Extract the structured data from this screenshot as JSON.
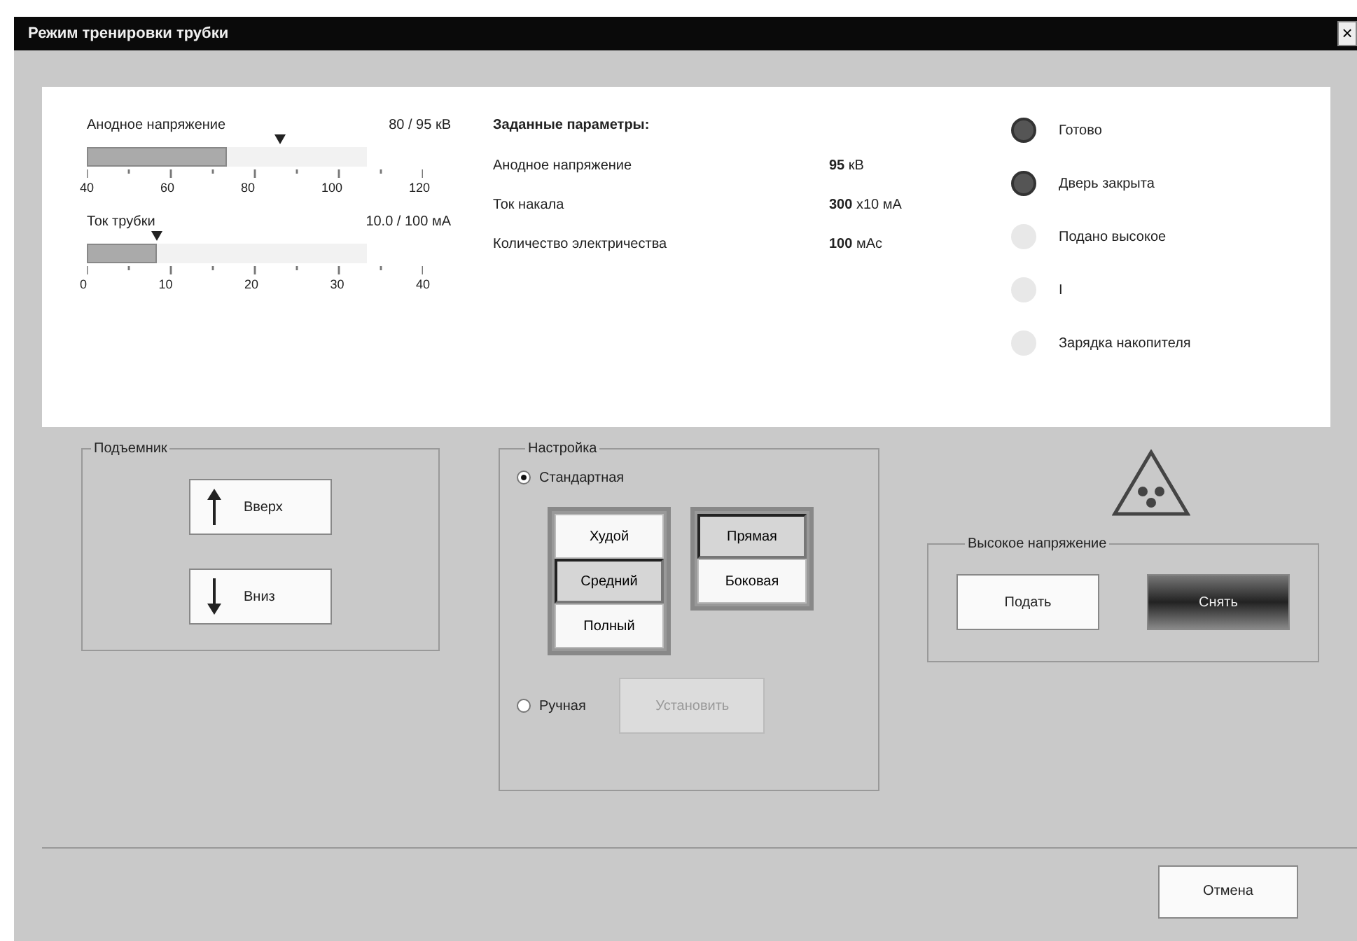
{
  "window": {
    "title": "Режим тренировки трубки",
    "close": "×"
  },
  "gauges": [
    {
      "label": "Анодное напряжение",
      "reading": "80 / 95 кВ",
      "level": 0.5,
      "marker": {
        "level": 0.6875
      },
      "ticks": [
        "40",
        "60",
        "80",
        "100",
        "120"
      ]
    },
    {
      "label": "Ток трубки",
      "reading": "10.0 / 100 мА",
      "level": 0.25,
      "marker": {
        "level": 0.25
      },
      "ticks": [
        "0",
        "10",
        "20",
        "30",
        "40"
      ]
    }
  ],
  "set_parameters": {
    "title": "Заданные параметры:",
    "rows": [
      {
        "name": "Анодное напряжение",
        "value": "95",
        "unit": "кВ"
      },
      {
        "name": "Ток накала",
        "value": "300",
        "unit": "x10 мА"
      },
      {
        "name": "Количество электричества",
        "value": "100",
        "unit": "мАс"
      }
    ]
  },
  "indicators": [
    {
      "label": "Готово",
      "on": true
    },
    {
      "label": "Дверь закрыта",
      "on": true
    },
    {
      "label": "Подано высокое",
      "on": false
    },
    {
      "label": "I",
      "on": false
    },
    {
      "label": "Зарядка накопителя",
      "on": false
    }
  ],
  "lift": {
    "title": "Подъемник",
    "buttons": [
      {
        "label": "Вверх",
        "kind": "up"
      },
      {
        "label": "Вниз",
        "kind": "down"
      }
    ]
  },
  "setup": {
    "title": "Настройка",
    "modes": [
      {
        "label": "Стандартная",
        "selected": true
      },
      {
        "label": "Ручная",
        "selected": false
      }
    ],
    "body_types": [
      {
        "label": "Худой",
        "selected": false
      },
      {
        "label": "Средний",
        "selected": true
      },
      {
        "label": "Полный",
        "selected": false
      }
    ],
    "projections": [
      {
        "label": "Прямая",
        "selected": true
      },
      {
        "label": "Боковая",
        "selected": false
      }
    ],
    "apply": {
      "label": "Установить",
      "disabled": true
    }
  },
  "high_voltage": {
    "title": "Высокое напряжение",
    "buttons": [
      {
        "label": "Подать",
        "kind": "plain"
      },
      {
        "label": "Снять",
        "kind": "dark"
      }
    ]
  },
  "cancel": "Отмена"
}
